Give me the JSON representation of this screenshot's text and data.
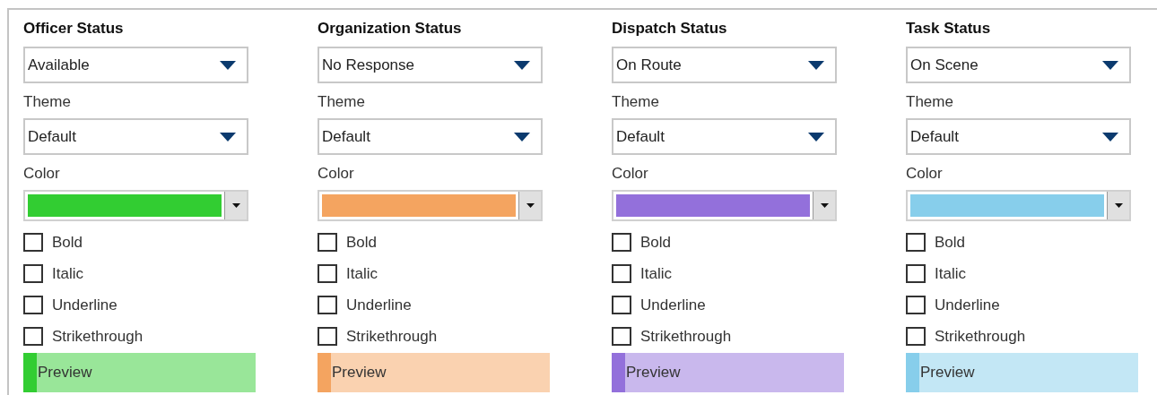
{
  "columns": [
    {
      "title": "Officer Status",
      "status": {
        "value": "Available"
      },
      "theme_label": "Theme",
      "theme": {
        "value": "Default"
      },
      "color_label": "Color",
      "color": "#32cd32",
      "options": [
        {
          "label": "Bold",
          "checked": false
        },
        {
          "label": "Italic",
          "checked": false
        },
        {
          "label": "Underline",
          "checked": false
        },
        {
          "label": "Strikethrough",
          "checked": false
        }
      ],
      "preview": "Preview"
    },
    {
      "title": "Organization Status",
      "status": {
        "value": "No Response"
      },
      "theme_label": "Theme",
      "theme": {
        "value": "Default"
      },
      "color_label": "Color",
      "color": "#f4a460",
      "options": [
        {
          "label": "Bold",
          "checked": false
        },
        {
          "label": "Italic",
          "checked": false
        },
        {
          "label": "Underline",
          "checked": false
        },
        {
          "label": "Strikethrough",
          "checked": false
        }
      ],
      "preview": "Preview"
    },
    {
      "title": "Dispatch Status",
      "status": {
        "value": "On Route"
      },
      "theme_label": "Theme",
      "theme": {
        "value": "Default"
      },
      "color_label": "Color",
      "color": "#9370db",
      "options": [
        {
          "label": "Bold",
          "checked": false
        },
        {
          "label": "Italic",
          "checked": false
        },
        {
          "label": "Underline",
          "checked": false
        },
        {
          "label": "Strikethrough",
          "checked": false
        }
      ],
      "preview": "Preview"
    },
    {
      "title": "Task Status",
      "status": {
        "value": "On Scene"
      },
      "theme_label": "Theme",
      "theme": {
        "value": "Default"
      },
      "color_label": "Color",
      "color": "#87ceeb",
      "options": [
        {
          "label": "Bold",
          "checked": false
        },
        {
          "label": "Italic",
          "checked": false
        },
        {
          "label": "Underline",
          "checked": false
        },
        {
          "label": "Strikethrough",
          "checked": false
        }
      ],
      "preview": "Preview"
    }
  ]
}
